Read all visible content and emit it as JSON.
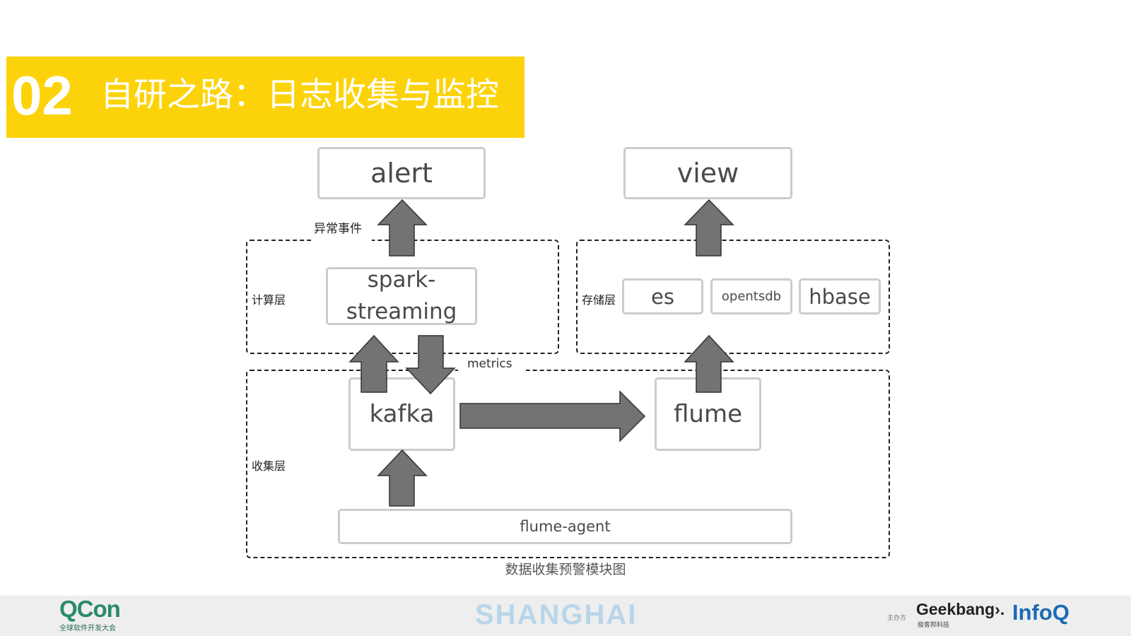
{
  "title": {
    "number": "02",
    "text": "自研之路：日志收集与监控"
  },
  "diagram": {
    "zones": {
      "compute": "计算层",
      "storage": "存储层",
      "collect": "收集层"
    },
    "edge_labels": {
      "anomaly": "异常事件",
      "metrics": "metrics"
    },
    "nodes": {
      "alert": "alert",
      "view": "view",
      "spark_line1": "spark-",
      "spark_line2": "streaming",
      "es": "es",
      "opentsdb": "opentsdb",
      "hbase": "hbase",
      "kafka": "kafka",
      "flume": "flume",
      "flume_agent": "flume-agent"
    },
    "caption": "数据收集预警模块图",
    "colors": {
      "arrow_fill": "#737373",
      "arrow_stroke": "#333333",
      "box_border": "#c9cdcd",
      "title_bg": "#fcd30a"
    }
  },
  "footer": {
    "qcon": "QCon",
    "qcon_sub": "全球软件开发大会",
    "city": "SHANGHAI",
    "host_label": "主办方",
    "geekbang": "Geekbang›.",
    "geekbang_sub": "极客邦科技",
    "infoq": "InfoQ"
  }
}
